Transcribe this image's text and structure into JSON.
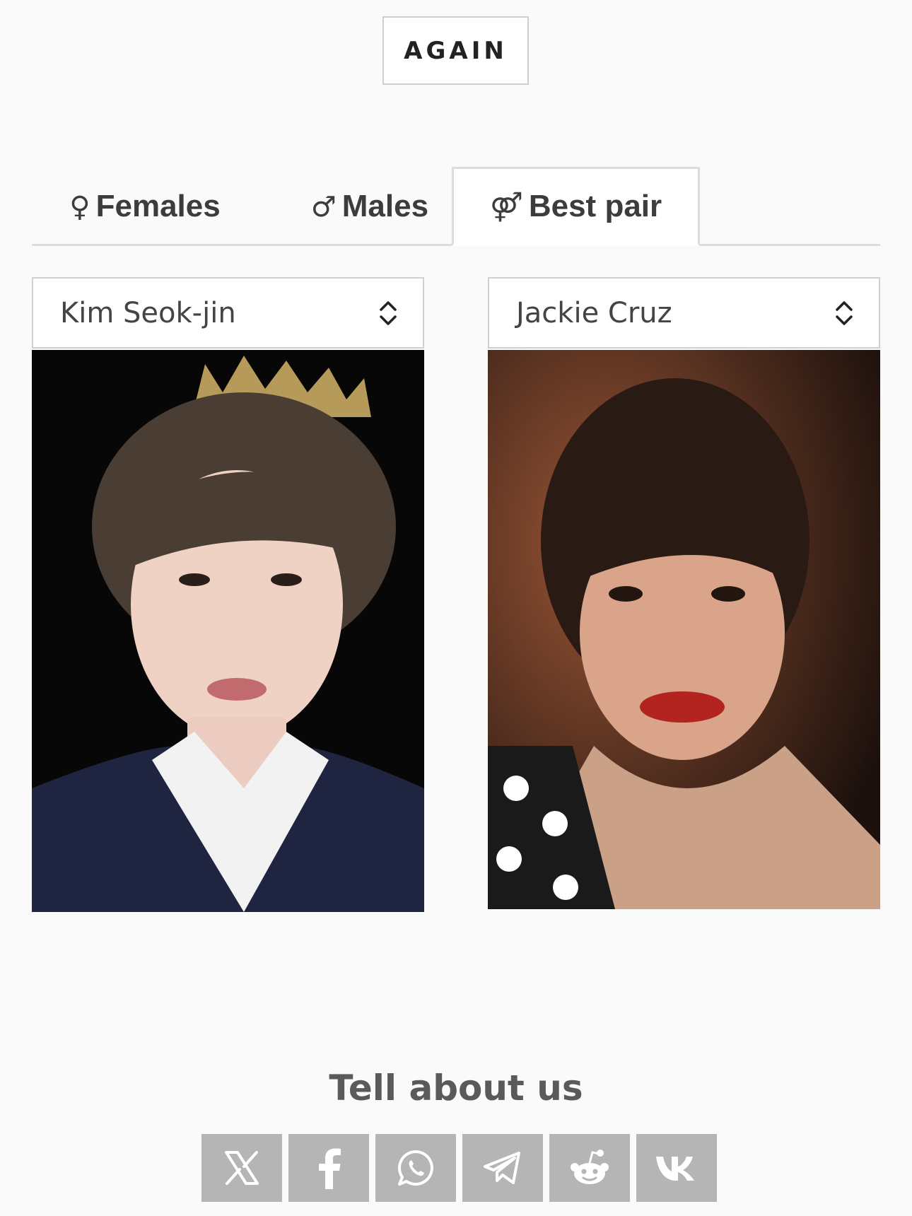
{
  "again_button": {
    "label": "AGAIN"
  },
  "tabs": [
    {
      "symbol": "♀",
      "label": "Females",
      "active": false
    },
    {
      "symbol": "♂",
      "label": "Males",
      "active": false
    },
    {
      "symbol": "⚤",
      "label": "Best pair",
      "active": true
    }
  ],
  "pair": {
    "left": {
      "name": "Kim Seok-jin"
    },
    "right": {
      "name": "Jackie Cruz"
    }
  },
  "share": {
    "title": "Tell about us",
    "buttons": [
      "x-icon",
      "facebook-icon",
      "whatsapp-icon",
      "telegram-icon",
      "reddit-icon",
      "vk-icon"
    ]
  },
  "colors": {
    "background": "#fafafa",
    "share_button": "#b5b5b5",
    "border": "#dcdcdc"
  }
}
